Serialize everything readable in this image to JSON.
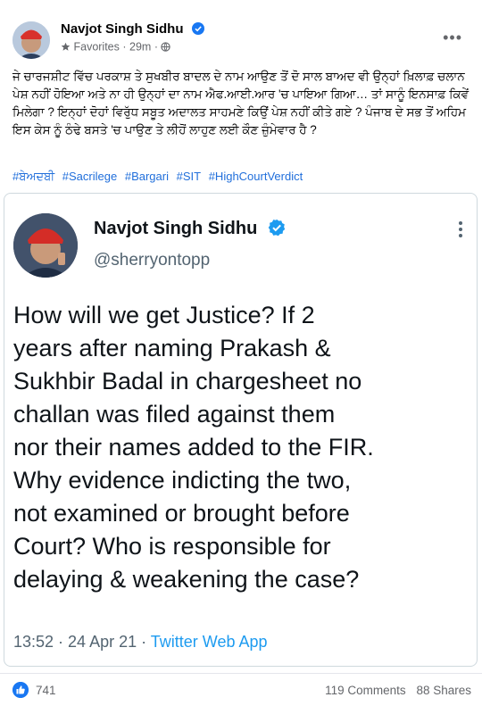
{
  "post": {
    "author": "Navjot Singh Sidhu",
    "audience": "Favorites",
    "time": "29m",
    "text": "ਜੇ ਚਾਰਜਸ਼ੀਟ ਵਿੱਚ ਪਰਕਾਸ਼ ਤੇ ਸੁਖਬੀਰ ਬਾਦਲ ਦੇ ਨਾਮ ਆਉਣ ਤੋਂ ਦੋ ਸਾਲ ਬਾਅਦ ਵੀ ਉਨ੍ਹਾਂ ਖ਼ਿਲਾਫ਼ ਚਲਾਨ ਪੇਸ਼ ਨਹੀਂ ਹੋਇਆ ਅਤੇ ਨਾ ਹੀ ਉਨ੍ਹਾਂ ਦਾ ਨਾਮ ਐਫ.ਆਈ.ਆਰ 'ਚ ਪਾਇਆ ਗਿਆ… ਤਾਂ ਸਾਨੂੰ ਇਨਸਾਫ਼ ਕਿਵੇਂ ਮਿਲੇਗਾ ? ਇਨ੍ਹਾਂ ਦੋਹਾਂ ਵਿਰੁੱਧ ਸਬੂਤ ਅਦਾਲਤ ਸਾਹਮਣੇ ਕਿਉਂ ਪੇਸ਼ ਨਹੀਂ ਕੀਤੇ ਗਏ ? ਪੰਜਾਬ ਦੇ ਸਭ ਤੋਂ ਅਹਿਮ ਇਸ ਕੇਸ ਨੂੰ ਠੰਢੇ ਬਸਤੇ 'ਚ ਪਾਉਣ ਤੇ ਲੀਹੋਂ ਲਾਹੁਣ ਲਈ ਕੌਣ ਜ਼ੁੰਮੇਵਾਰ ਹੈ ?",
    "hashtags": [
      "#ਬੇਅਦਬੀ",
      "#Sacrilege",
      "#Bargari",
      "#SIT",
      "#HighCourtVerdict"
    ]
  },
  "tweet": {
    "name": "Navjot Singh Sidhu",
    "handle": "@sherryontopp",
    "text": "How will we get Justice? If 2\nyears after naming Prakash &\nSukhbir Badal in chargesheet no\nchallan was filed against them\nnor their names added to the FIR.\nWhy evidence indicting the two,\nnot examined or brought before\nCourt? Who is responsible for\ndelaying & weakening the case?",
    "timestamp": "13:52 · 24 Apr 21 · ",
    "source": "Twitter Web App"
  },
  "footer": {
    "likes": "741",
    "comments": "119 Comments",
    "shares": "88 Shares"
  },
  "colors": {
    "link": "#216fdb",
    "verified": "#1877f2",
    "twitter_blue": "#1d9bf0"
  }
}
